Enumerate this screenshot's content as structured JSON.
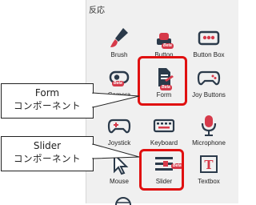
{
  "panel": {
    "title": "反応"
  },
  "tiles": {
    "brush": {
      "label": "Brush"
    },
    "button": {
      "label": "Button",
      "badge": "Beta"
    },
    "button_box": {
      "label": "Button Box"
    },
    "camera": {
      "label": "Camera",
      "badge": "Beta"
    },
    "form": {
      "label": "Form",
      "badge": "Beta"
    },
    "joy_buttons": {
      "label": "Joy Buttons"
    },
    "joystick": {
      "label": "Joystick"
    },
    "keyboard": {
      "label": "Keyboard"
    },
    "microphone": {
      "label": "Microphone"
    },
    "mouse": {
      "label": "Mouse"
    },
    "slider": {
      "label": "Slider",
      "badge": "Beta"
    },
    "textbox": {
      "label": "Textbox"
    }
  },
  "callouts": {
    "form": {
      "line1": "Form",
      "line2": "コンポーネント"
    },
    "slider": {
      "line1": "Slider",
      "line2": "コンポーネント"
    }
  },
  "colors": {
    "accent_red": "#e01010",
    "icon_dark": "#2b3a4a",
    "beta_red": "#d63a4a"
  }
}
